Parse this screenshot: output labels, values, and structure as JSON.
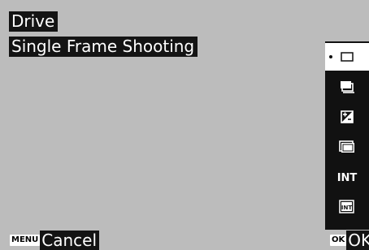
{
  "header": {
    "title": "Drive",
    "subtitle": "Single Frame Shooting"
  },
  "drive_menu": {
    "items": [
      {
        "icon": "single-frame-icon",
        "selected": true
      },
      {
        "icon": "continuous-shooting-icon",
        "selected": false
      },
      {
        "icon": "exposure-bracketing-icon",
        "selected": false
      },
      {
        "icon": "multi-exposure-icon",
        "selected": false
      },
      {
        "icon": "interval-shooting-icon",
        "selected": false,
        "text": "INT"
      },
      {
        "icon": "interval-composite-icon",
        "selected": false,
        "text": "INT"
      }
    ]
  },
  "footer": {
    "cancel_key": "MENU",
    "cancel_label": "Cancel",
    "ok_key": "OK",
    "ok_label": "OK"
  },
  "colors": {
    "background": "#bcbcbc",
    "panel": "#111111",
    "selected_item": "#ffffff",
    "text": "#ffffff"
  }
}
